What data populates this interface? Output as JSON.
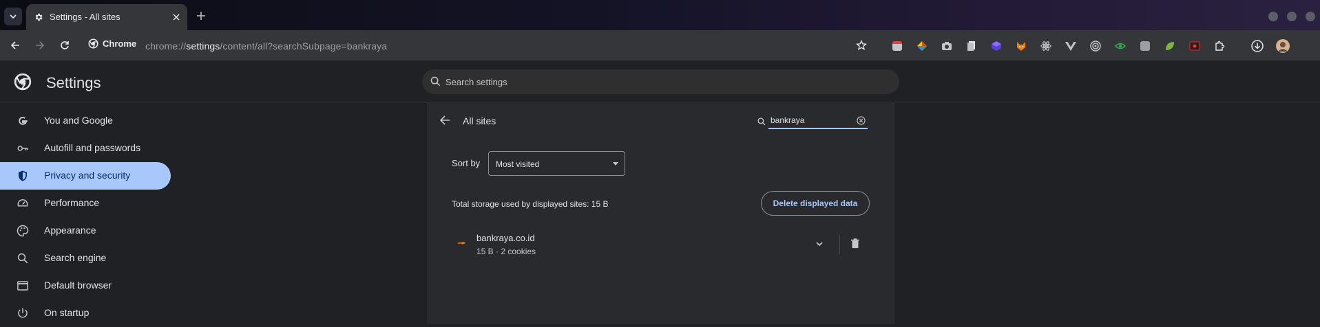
{
  "browser": {
    "tab_title": "Settings - All sites",
    "address_chip": "Chrome",
    "url_scheme": "chrome://",
    "url_host": "settings",
    "url_path": "/content/all?searchSubpage=bankraya",
    "colors": {
      "tabstrip": "#141326",
      "toolbar": "#35363a"
    },
    "extension_icons": [
      "tabs-ext-icon",
      "palette-ext-icon",
      "camera-ext-icon",
      "document-ext-icon",
      "cube-ext-icon",
      "fox-ext-icon",
      "react-ext-icon",
      "vue-ext-icon",
      "target-ext-icon",
      "eye-ext-icon",
      "square-ext-icon",
      "leaf-ext-icon",
      "record-ext-icon",
      "puzzle-ext-icon",
      "download-icon",
      "avatar"
    ]
  },
  "settings": {
    "title": "Settings",
    "search_placeholder": "Search settings"
  },
  "sidebar": {
    "items": [
      {
        "label": "You and Google",
        "icon": "google-g-icon",
        "active": false
      },
      {
        "label": "Autofill and passwords",
        "icon": "key-icon",
        "active": false
      },
      {
        "label": "Privacy and security",
        "icon": "shield-icon",
        "active": true
      },
      {
        "label": "Performance",
        "icon": "speedometer-icon",
        "active": false
      },
      {
        "label": "Appearance",
        "icon": "palette-icon",
        "active": false
      },
      {
        "label": "Search engine",
        "icon": "search-icon",
        "active": false
      },
      {
        "label": "Default browser",
        "icon": "browser-window-icon",
        "active": false
      },
      {
        "label": "On startup",
        "icon": "power-icon",
        "active": false
      }
    ]
  },
  "main": {
    "heading": "All sites",
    "filter_value": "bankraya",
    "sort_label": "Sort by",
    "sort_value": "Most visited",
    "storage_text": "Total storage used by displayed sites: 15 B",
    "delete_button": "Delete displayed data",
    "sites": [
      {
        "name": "bankraya.co.id",
        "meta": "15 B · 2 cookies"
      }
    ],
    "colors": {
      "accent": "#a8c7fa",
      "card": "#292a2d"
    }
  }
}
